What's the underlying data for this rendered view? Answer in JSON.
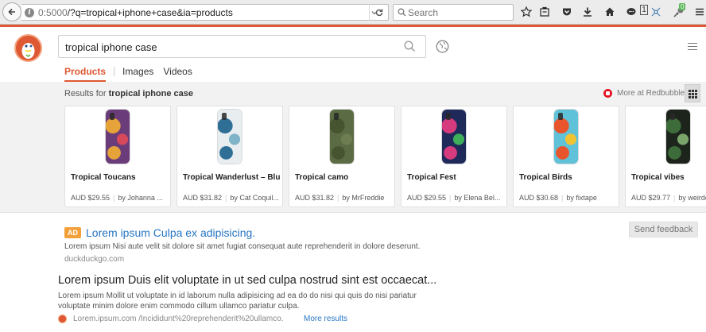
{
  "browser": {
    "url_host": "0:5000",
    "url_path": "/?q=tropical+iphone+case&ia=products",
    "search_placeholder": "Search",
    "badge_count": "1",
    "addon_badge": "0"
  },
  "ddg": {
    "query": "tropical iphone case",
    "tabs": [
      {
        "label": "Products"
      },
      {
        "label": "Images"
      },
      {
        "label": "Videos"
      }
    ]
  },
  "products": {
    "results_prefix": "Results for ",
    "results_query": "tropical iphone case",
    "more_at": "More at Redbubble",
    "items": [
      {
        "title": "Tropical Toucans",
        "price": "AUD $29.55",
        "seller": "by Johanna ...",
        "colors": [
          "#6a3d7a",
          "#e6a33a",
          "#d6485a"
        ]
      },
      {
        "title": "Tropical Wanderlust – Blue",
        "price": "AUD $31.82",
        "seller": "by Cat Coquil...",
        "colors": [
          "#e8eef0",
          "#2f6f96",
          "#7fb4c8"
        ]
      },
      {
        "title": "Tropical camo",
        "price": "AUD $31.82",
        "seller": "by MrFreddie",
        "colors": [
          "#5b6b43",
          "#46552f",
          "#6f7e52"
        ]
      },
      {
        "title": "Tropical Fest",
        "price": "AUD $29.55",
        "seller": "by Elena Bel...",
        "colors": [
          "#1f2a5a",
          "#d63b7d",
          "#3fae5b"
        ]
      },
      {
        "title": "Tropical Birds",
        "price": "AUD $30.68",
        "seller": "by fixtape",
        "colors": [
          "#5fc2d8",
          "#e8542b",
          "#f1c232"
        ]
      },
      {
        "title": "Tropical vibes",
        "price": "AUD $29.77",
        "seller": "by weirdo",
        "colors": [
          "#1c241c",
          "#3d6b39",
          "#7aa46a"
        ]
      }
    ]
  },
  "feedback_label": "Send feedback",
  "ad": {
    "badge": "AD",
    "title": "Lorem ipsum Culpa ex adipisicing.",
    "snippet": "Lorem ipsum Nisi aute velit sit dolore sit amet fugiat consequat aute reprehenderit in dolore deserunt.",
    "url": "duckduckgo.com"
  },
  "result": {
    "title": "Lorem ipsum Duis elit voluptate in ut sed culpa nostrud sint est occaecat...",
    "snippet": "Lorem ipsum Mollit ut voluptate in id laborum nulla adipisicing ad ea do do nisi qui quis do nisi pariatur voluptate minim dolore enim commodo cillum ullamco pariatur culpa.",
    "url": "Lorem.ipsum.com /Incididunt%20reprehenderit%20ullamco.",
    "more": "More results"
  },
  "colors": {
    "ddg_orange": "#de5833",
    "link_blue": "#2776c2",
    "ad_badge": "#f3a03a"
  }
}
